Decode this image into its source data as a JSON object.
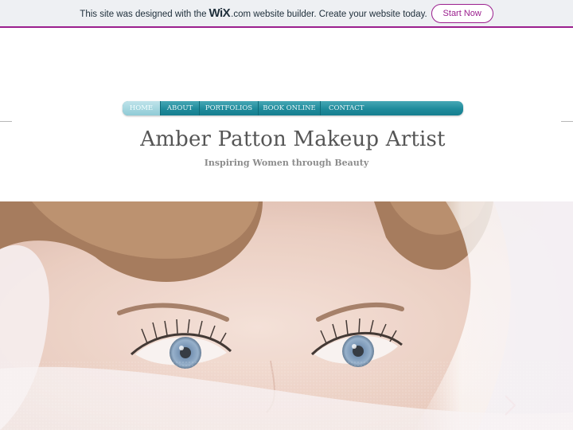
{
  "banner": {
    "text_before": "This site was designed with the",
    "logo": "WiX",
    "text_after": ".com website builder. Create your website today.",
    "button": "Start Now",
    "accent_color": "#9b1f8e"
  },
  "nav": {
    "items": [
      {
        "label": "HOME",
        "active": true
      },
      {
        "label": "ABOUT"
      },
      {
        "label": "PORTFOLIOS"
      },
      {
        "label": "BOOK ONLINE"
      },
      {
        "label": "CONTACT"
      }
    ],
    "color": "#1f8b9b"
  },
  "header": {
    "title": "Amber Patton Makeup Artist",
    "tagline": "Inspiring Women through Beauty"
  },
  "hero": {
    "image": "bride-face-with-veil-photo",
    "next_icon": "chevron-right-icon"
  }
}
